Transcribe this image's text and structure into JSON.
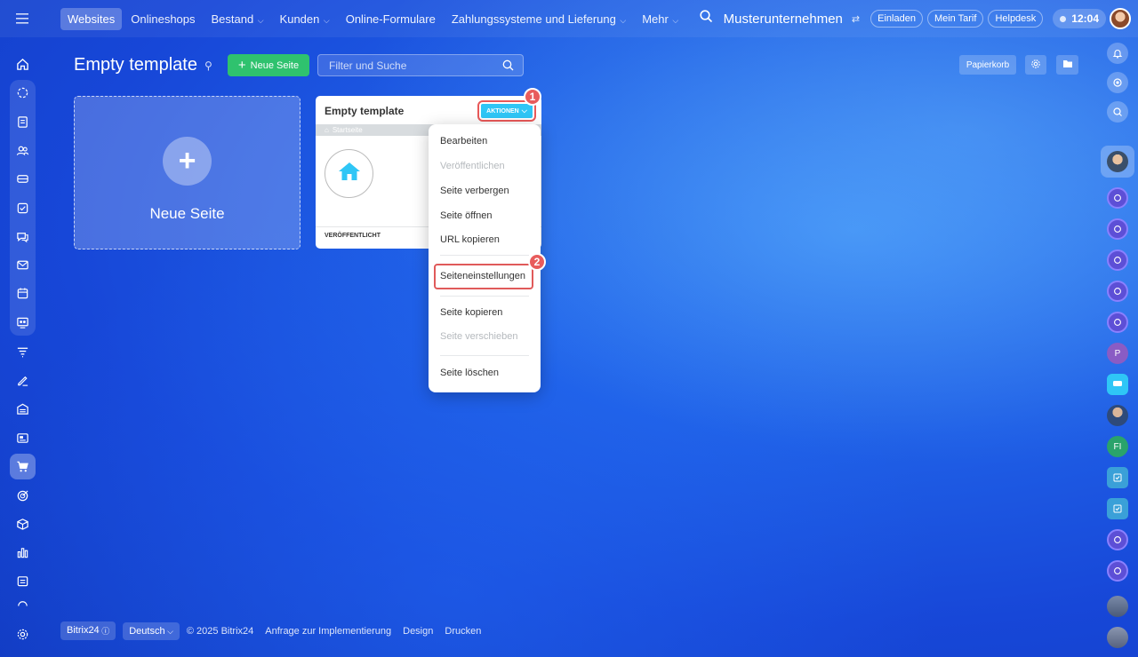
{
  "topbar": {
    "nav": [
      {
        "label": "Websites",
        "active": true,
        "has_chevron": false
      },
      {
        "label": "Onlineshops",
        "active": false,
        "has_chevron": false
      },
      {
        "label": "Bestand",
        "active": false,
        "has_chevron": true
      },
      {
        "label": "Kunden",
        "active": false,
        "has_chevron": true
      },
      {
        "label": "Online-Formulare",
        "active": false,
        "has_chevron": false
      },
      {
        "label": "Zahlungssysteme und Lieferung",
        "active": false,
        "has_chevron": true
      },
      {
        "label": "Mehr",
        "active": false,
        "has_chevron": true
      }
    ],
    "company": "Musterunternehmen",
    "invite": "Einladen",
    "plan": "Mein Tarif",
    "helpdesk": "Helpdesk",
    "time": "12:04"
  },
  "header": {
    "title": "Empty template",
    "new_page_button": "Neue Seite",
    "search_placeholder": "Filter und Suche",
    "recycle_bin": "Papierkorb"
  },
  "new_tile": {
    "label": "Neue Seite"
  },
  "site_card": {
    "title": "Empty template",
    "actions_button": "AKTIONEN",
    "breadcrumb": "Startseite",
    "status": "VERÖFFENTLICHT"
  },
  "actions_menu": {
    "items": [
      {
        "label": "Bearbeiten",
        "disabled": false
      },
      {
        "label": "Veröffentlichen",
        "disabled": true
      },
      {
        "label": "Seite verbergen",
        "disabled": false
      },
      {
        "label": "Seite öffnen",
        "disabled": false
      },
      {
        "label": "URL kopieren",
        "disabled": false
      },
      {
        "label": "Seiteneinstellungen",
        "disabled": false
      },
      {
        "label": "Seite kopieren",
        "disabled": false
      },
      {
        "label": "Seite verschieben",
        "disabled": true
      },
      {
        "label": "Seite löschen",
        "disabled": false
      }
    ]
  },
  "callouts": {
    "step1": "1",
    "step2": "2"
  },
  "right_sidebar": {
    "initial_p": "P",
    "initial_fi": "FI"
  },
  "footer": {
    "brand": "Bitrix24",
    "language": "Deutsch",
    "copyright": "© 2025 Bitrix24",
    "links": [
      "Anfrage zur Implementierung",
      "Design",
      "Drucken"
    ]
  },
  "colors": {
    "background": "#1f5fe6",
    "new_button": "#2fc26e",
    "actions_button": "#2fc6f6",
    "highlight": "#e85c5c"
  }
}
